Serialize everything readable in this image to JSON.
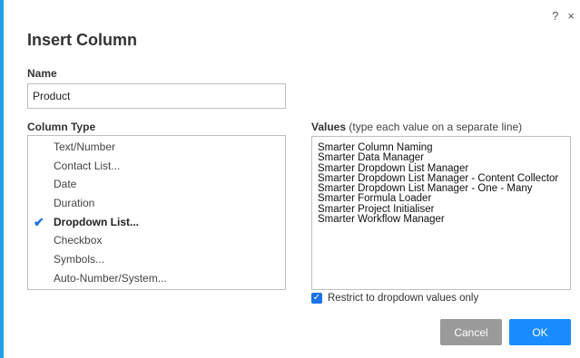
{
  "dialog": {
    "title": "Insert Column",
    "help_label": "?",
    "close_label": "×"
  },
  "name_field": {
    "label": "Name",
    "value": "Product"
  },
  "column_type": {
    "label": "Column Type",
    "items": [
      {
        "label": "Text/Number",
        "selected": false
      },
      {
        "label": "Contact List...",
        "selected": false
      },
      {
        "label": "Date",
        "selected": false
      },
      {
        "label": "Duration",
        "selected": false
      },
      {
        "label": "Dropdown List...",
        "selected": true
      },
      {
        "label": "Checkbox",
        "selected": false
      },
      {
        "label": "Symbols...",
        "selected": false
      },
      {
        "label": "Auto-Number/System...",
        "selected": false
      }
    ]
  },
  "values": {
    "label": "Values",
    "hint": "(type each value on a separate line)",
    "lines": [
      "Smarter Column Naming",
      "Smarter Data Manager",
      "Smarter Dropdown List Manager",
      "Smarter Dropdown List Manager - Content Collector",
      "Smarter Dropdown List Manager - One - Many",
      "Smarter Formula Loader",
      "Smarter Project Initialiser",
      "Smarter Workflow Manager"
    ]
  },
  "restrict": {
    "checked": true,
    "label": "Restrict to dropdown values only"
  },
  "buttons": {
    "cancel": "Cancel",
    "ok": "OK"
  },
  "colors": {
    "accent": "#1a73e8",
    "ok_button": "#1a8cff",
    "cancel_button": "#9a9a9a",
    "left_border": "#1da1e6"
  }
}
